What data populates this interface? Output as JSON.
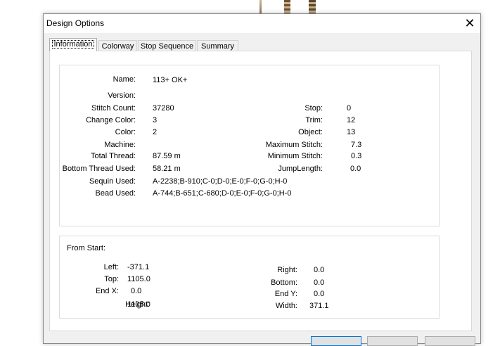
{
  "window": {
    "title": "Design Options"
  },
  "tabs": [
    {
      "label": "Information"
    },
    {
      "label": "Colorway"
    },
    {
      "label": "Stop Sequence"
    },
    {
      "label": "Summary"
    }
  ],
  "info": {
    "name": {
      "label": "Name:",
      "value": "113+ OK+"
    },
    "version": {
      "label": "Version:",
      "value": ""
    },
    "stitch_count": {
      "label": "Stitch Count:",
      "value": "37280"
    },
    "change_color": {
      "label": "Change Color:",
      "value": "3"
    },
    "color": {
      "label": "Color:",
      "value": "2"
    },
    "machine": {
      "label": "Machine:",
      "value": ""
    },
    "total_thread": {
      "label": "Total Thread:",
      "value": "87.59 m"
    },
    "bottom_thread": {
      "label": "Bottom Thread Used:",
      "value": "58.21 m"
    },
    "sequin_used": {
      "label": "Sequin Used:",
      "value": "A-2238;B-910;C-0;D-0;E-0;F-0;G-0;H-0"
    },
    "bead_used": {
      "label": "Bead Used:",
      "value": "A-744;B-651;C-680;D-0;E-0;F-0;G-0;H-0"
    },
    "stop": {
      "label": "Stop:",
      "value": "0"
    },
    "trim": {
      "label": "Trim:",
      "value": "12"
    },
    "object": {
      "label": "Object:",
      "value": "13"
    },
    "max_stitch": {
      "label": "Maximum Stitch:",
      "value": "7.3"
    },
    "min_stitch": {
      "label": "Minimum Stitch:",
      "value": "0.3"
    },
    "jump_length": {
      "label": "JumpLength:",
      "value": "0.0"
    }
  },
  "from_start": {
    "title": "From Start:",
    "left": {
      "label": "Left:",
      "value": "-371.1"
    },
    "top": {
      "label": "Top:",
      "value": "1105.0"
    },
    "end_x": {
      "label": "End X:",
      "value": "0.0"
    },
    "height": {
      "label": "Height:",
      "value": "1105.0"
    },
    "right": {
      "label": "Right:",
      "value": "0.0"
    },
    "bottom": {
      "label": "Bottom:",
      "value": "0.0"
    },
    "end_y": {
      "label": "End Y:",
      "value": "0.0"
    },
    "width": {
      "label": "Width:",
      "value": "371.1"
    }
  },
  "colors": {
    "accent": "#0078d7",
    "dialog_bg": "#f0f0f0"
  }
}
